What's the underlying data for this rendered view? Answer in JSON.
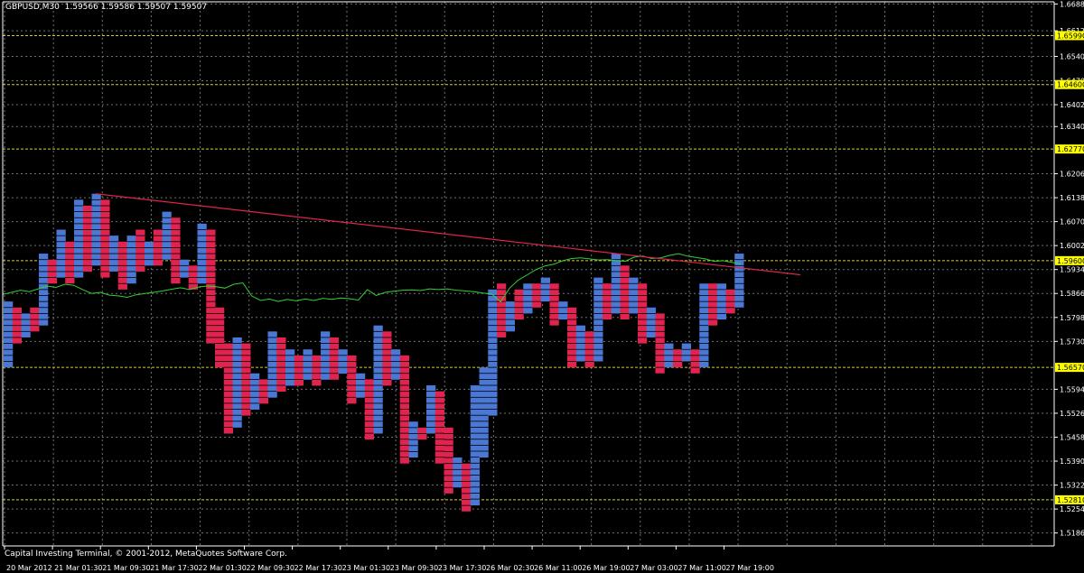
{
  "window": {
    "symbol_label": "GBPUSD,M30",
    "ohlc_label": "1.59566 1.59586 1.59507 1.59507",
    "copyright": "Capital Investing Terminal, © 2001-2012, MetaQuotes Software Corp."
  },
  "colors": {
    "background": "#000000",
    "grid": "#6c7570",
    "axis": "#ffffff",
    "up_box": "#4a78d4",
    "down_box": "#e0234f",
    "box_grid": "#000000",
    "ma_line": "#32d232",
    "trendline": "#e0234f",
    "level_line": "#d6d12a",
    "level_label_bg": "#ffff00"
  },
  "chart_data": {
    "type": "point-and-figure",
    "symbol": "GBPUSD",
    "timeframe": "M30",
    "ylim": [
      1.515,
      1.6695
    ],
    "ytick_labels": [
      "1.66888",
      "1.66128",
      "1.65990",
      "1.65400",
      "1.64708",
      "1.64600",
      "1.64028",
      "1.63408",
      "1.62770",
      "1.62068",
      "1.61388",
      "1.60708",
      "1.60028",
      "1.59600",
      "1.59348",
      "1.58668",
      "1.57988",
      "1.57308",
      "1.56570",
      "1.55948",
      "1.55268",
      "1.54588",
      "1.53908",
      "1.53228",
      "1.52810",
      "1.52548",
      "1.51868"
    ],
    "horizontal_levels": [
      1.6599,
      1.646,
      1.6277,
      1.596,
      1.5657,
      1.5281
    ],
    "x_labels": [
      "20 Mar 2012",
      "21 Mar 01:30",
      "21 Mar 09:30",
      "21 Mar 17:30",
      "22 Mar 01:30",
      "22 Mar 09:30",
      "22 Mar 17:30",
      "23 Mar 01:30",
      "23 Mar 09:30",
      "23 Mar 17:30",
      "26 Mar 02:30",
      "26 Mar 11:00",
      "26 Mar 19:00",
      "27 Mar 03:00",
      "27 Mar 11:00",
      "27 Mar 19:00"
    ],
    "box_size": 0.0017,
    "columns": [
      {
        "dir": "up",
        "low": 1.5657,
        "high": 1.5844
      },
      {
        "dir": "down",
        "low": 1.5725,
        "high": 1.5827
      },
      {
        "dir": "up",
        "low": 1.5742,
        "high": 1.581
      },
      {
        "dir": "down",
        "low": 1.5759,
        "high": 1.5827
      },
      {
        "dir": "up",
        "low": 1.5776,
        "high": 1.598
      },
      {
        "dir": "down",
        "low": 1.5895,
        "high": 1.5963
      },
      {
        "dir": "up",
        "low": 1.5912,
        "high": 1.6048
      },
      {
        "dir": "down",
        "low": 1.5895,
        "high": 1.6014
      },
      {
        "dir": "up",
        "low": 1.5912,
        "high": 1.6133
      },
      {
        "dir": "down",
        "low": 1.5929,
        "high": 1.6116
      },
      {
        "dir": "up",
        "low": 1.5946,
        "high": 1.615
      },
      {
        "dir": "down",
        "low": 1.5912,
        "high": 1.6133
      },
      {
        "dir": "up",
        "low": 1.5929,
        "high": 1.6031
      },
      {
        "dir": "down",
        "low": 1.5878,
        "high": 1.6014
      },
      {
        "dir": "up",
        "low": 1.5895,
        "high": 1.6031
      },
      {
        "dir": "down",
        "low": 1.5929,
        "high": 1.6048
      },
      {
        "dir": "up",
        "low": 1.5946,
        "high": 1.6014
      },
      {
        "dir": "down",
        "low": 1.5946,
        "high": 1.6048
      },
      {
        "dir": "up",
        "low": 1.5963,
        "high": 1.6099
      },
      {
        "dir": "down",
        "low": 1.5895,
        "high": 1.6082
      },
      {
        "dir": "up",
        "low": 1.5912,
        "high": 1.5963
      },
      {
        "dir": "down",
        "low": 1.5878,
        "high": 1.5946
      },
      {
        "dir": "up",
        "low": 1.5895,
        "high": 1.6065
      },
      {
        "dir": "down",
        "low": 1.5725,
        "high": 1.6048
      },
      {
        "dir": "down",
        "low": 1.5657,
        "high": 1.5827
      },
      {
        "dir": "down",
        "low": 1.5469,
        "high": 1.5725
      },
      {
        "dir": "up",
        "low": 1.5486,
        "high": 1.5742
      },
      {
        "dir": "down",
        "low": 1.552,
        "high": 1.5725
      },
      {
        "dir": "up",
        "low": 1.5537,
        "high": 1.564
      },
      {
        "dir": "down",
        "low": 1.5554,
        "high": 1.5623
      },
      {
        "dir": "up",
        "low": 1.5571,
        "high": 1.5759
      },
      {
        "dir": "down",
        "low": 1.5588,
        "high": 1.5742
      },
      {
        "dir": "up",
        "low": 1.5605,
        "high": 1.5708
      },
      {
        "dir": "down",
        "low": 1.5605,
        "high": 1.5691
      },
      {
        "dir": "up",
        "low": 1.5622,
        "high": 1.5708
      },
      {
        "dir": "down",
        "low": 1.5605,
        "high": 1.5691
      },
      {
        "dir": "up",
        "low": 1.5622,
        "high": 1.5759
      },
      {
        "dir": "down",
        "low": 1.5622,
        "high": 1.5742
      },
      {
        "dir": "up",
        "low": 1.5639,
        "high": 1.5708
      },
      {
        "dir": "down",
        "low": 1.5554,
        "high": 1.5691
      },
      {
        "dir": "up",
        "low": 1.5571,
        "high": 1.564
      },
      {
        "dir": "down",
        "low": 1.5452,
        "high": 1.5623
      },
      {
        "dir": "up",
        "low": 1.5469,
        "high": 1.5776
      },
      {
        "dir": "down",
        "low": 1.5605,
        "high": 1.5759
      },
      {
        "dir": "up",
        "low": 1.5622,
        "high": 1.5708
      },
      {
        "dir": "down",
        "low": 1.5384,
        "high": 1.5691
      },
      {
        "dir": "up",
        "low": 1.5401,
        "high": 1.5503
      },
      {
        "dir": "down",
        "low": 1.5452,
        "high": 1.5486
      },
      {
        "dir": "up",
        "low": 1.5469,
        "high": 1.5606
      },
      {
        "dir": "down",
        "low": 1.5384,
        "high": 1.5589
      },
      {
        "dir": "down",
        "low": 1.5299,
        "high": 1.5486
      },
      {
        "dir": "up",
        "low": 1.5316,
        "high": 1.5401
      },
      {
        "dir": "down",
        "low": 1.5248,
        "high": 1.5384
      },
      {
        "dir": "up",
        "low": 1.5265,
        "high": 1.5606
      },
      {
        "dir": "up",
        "low": 1.5401,
        "high": 1.5657
      },
      {
        "dir": "up",
        "low": 1.552,
        "high": 1.5878
      },
      {
        "dir": "down",
        "low": 1.5742,
        "high": 1.5895
      },
      {
        "dir": "up",
        "low": 1.5759,
        "high": 1.5844
      },
      {
        "dir": "down",
        "low": 1.5793,
        "high": 1.5878
      },
      {
        "dir": "up",
        "low": 1.581,
        "high": 1.5895
      },
      {
        "dir": "down",
        "low": 1.5827,
        "high": 1.5895
      },
      {
        "dir": "up",
        "low": 1.5844,
        "high": 1.5912
      },
      {
        "dir": "down",
        "low": 1.5776,
        "high": 1.5895
      },
      {
        "dir": "up",
        "low": 1.5793,
        "high": 1.5844
      },
      {
        "dir": "down",
        "low": 1.5657,
        "high": 1.5827
      },
      {
        "dir": "up",
        "low": 1.5674,
        "high": 1.5776
      },
      {
        "dir": "down",
        "low": 1.5657,
        "high": 1.5759
      },
      {
        "dir": "up",
        "low": 1.5674,
        "high": 1.5912
      },
      {
        "dir": "down",
        "low": 1.5793,
        "high": 1.5895
      },
      {
        "dir": "up",
        "low": 1.581,
        "high": 1.598
      },
      {
        "dir": "down",
        "low": 1.5793,
        "high": 1.5946
      },
      {
        "dir": "up",
        "low": 1.581,
        "high": 1.5912
      },
      {
        "dir": "down",
        "low": 1.5725,
        "high": 1.5895
      },
      {
        "dir": "up",
        "low": 1.5742,
        "high": 1.5827
      },
      {
        "dir": "down",
        "low": 1.564,
        "high": 1.581
      },
      {
        "dir": "up",
        "low": 1.5657,
        "high": 1.5725
      },
      {
        "dir": "down",
        "low": 1.5657,
        "high": 1.5708
      },
      {
        "dir": "up",
        "low": 1.5674,
        "high": 1.5725
      },
      {
        "dir": "down",
        "low": 1.564,
        "high": 1.5708
      },
      {
        "dir": "up",
        "low": 1.5657,
        "high": 1.5895
      },
      {
        "dir": "down",
        "low": 1.5776,
        "high": 1.5895
      },
      {
        "dir": "up",
        "low": 1.5793,
        "high": 1.5895
      },
      {
        "dir": "down",
        "low": 1.581,
        "high": 1.5878
      },
      {
        "dir": "up",
        "low": 1.5827,
        "high": 1.598
      }
    ],
    "trendline": {
      "x": [
        "21 Mar 09:30",
        "27 Mar 19:00"
      ],
      "y": [
        1.615,
        1.592
      ]
    },
    "moving_average": [
      1.5864,
      1.587,
      1.5876,
      1.5872,
      1.588,
      1.5888,
      1.5884,
      1.5893,
      1.589,
      1.5878,
      1.5867,
      1.587,
      1.5862,
      1.586,
      1.5856,
      1.5863,
      1.5867,
      1.587,
      1.5874,
      1.5879,
      1.5883,
      1.5878,
      1.5885,
      1.5888,
      1.5886,
      1.5882,
      1.5893,
      1.5897,
      1.586,
      1.5847,
      1.5851,
      1.5844,
      1.585,
      1.5846,
      1.5851,
      1.5847,
      1.5853,
      1.585,
      1.5854,
      1.5852,
      1.5848,
      1.5878,
      1.5861,
      1.587,
      1.5873,
      1.5876,
      1.5877,
      1.5875,
      1.588,
      1.5878,
      1.588,
      1.5876,
      1.5874,
      1.5872,
      1.5868,
      1.5865,
      1.5843,
      1.5882,
      1.5905,
      1.592,
      1.5935,
      1.5945,
      1.595,
      1.596,
      1.5966,
      1.5968,
      1.5965,
      1.5962,
      1.5963,
      1.596,
      1.5958,
      1.597,
      1.5973,
      1.5966,
      1.5968,
      1.5975,
      1.598,
      1.5973,
      1.5969,
      1.5965,
      1.5958,
      1.596,
      1.5955,
      1.5951
    ]
  }
}
